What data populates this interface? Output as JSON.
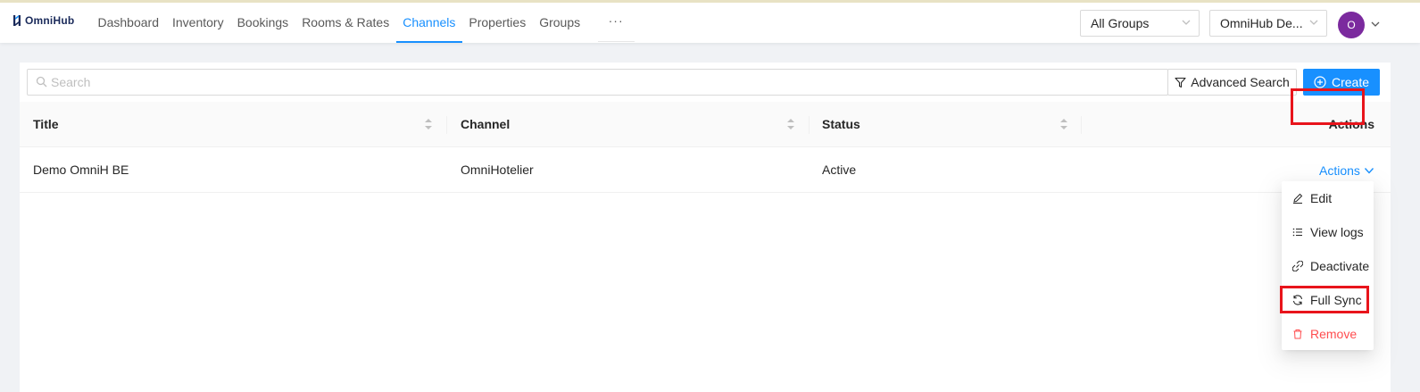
{
  "brand": {
    "name": "OmniHub"
  },
  "nav": {
    "items": [
      {
        "label": "Dashboard"
      },
      {
        "label": "Inventory"
      },
      {
        "label": "Bookings"
      },
      {
        "label": "Rooms & Rates"
      },
      {
        "label": "Channels"
      },
      {
        "label": "Properties"
      },
      {
        "label": "Groups"
      }
    ],
    "active": "Channels",
    "more": "···"
  },
  "header": {
    "group_select": "All Groups",
    "property_select": "OmniHub De...",
    "avatar_initial": "O"
  },
  "toolbar": {
    "search_placeholder": "Search",
    "advanced_search": "Advanced Search",
    "create": "Create"
  },
  "table": {
    "columns": [
      "Title",
      "Channel",
      "Status",
      "Actions"
    ],
    "rows": [
      {
        "title": "Demo OmniH BE",
        "channel": "OmniHotelier",
        "status": "Active",
        "actions": "Actions"
      }
    ]
  },
  "dropdown": {
    "items": [
      {
        "label": "Edit",
        "icon": "edit-icon"
      },
      {
        "label": "View logs",
        "icon": "list-icon"
      },
      {
        "label": "Deactivate",
        "icon": "link-break-icon"
      },
      {
        "label": "Full Sync",
        "icon": "sync-icon"
      },
      {
        "label": "Remove",
        "icon": "trash-icon"
      }
    ]
  },
  "colors": {
    "primary": "#1890ff",
    "danger": "#ff4d4f",
    "highlight": "#e8141b",
    "avatar": "#7b2a9e"
  }
}
